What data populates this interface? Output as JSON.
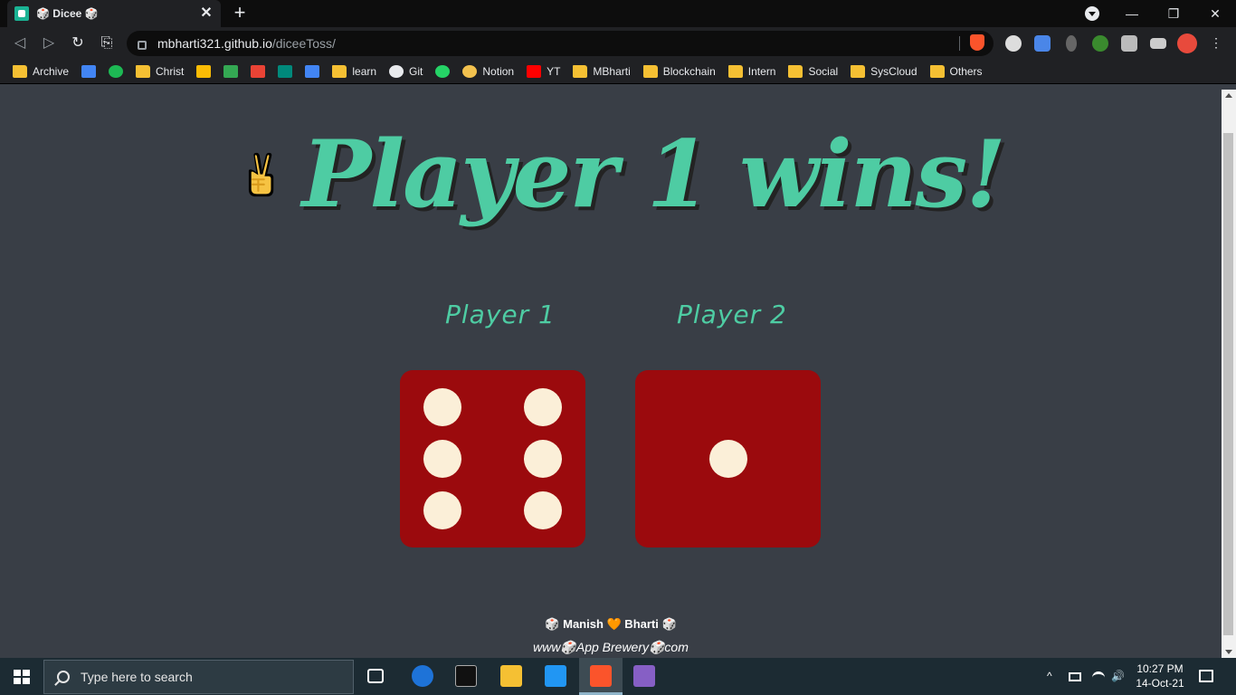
{
  "browser": {
    "tab_title": "🎲 Dicee 🎲",
    "tab_close": "✕",
    "new_tab": "+",
    "url_host": "mbharti321.github.io",
    "url_path": "/diceeToss/",
    "window_controls": [
      "—",
      "❐",
      "✕"
    ]
  },
  "bookmarks": [
    {
      "label": "Archive",
      "icon": "folder-icon"
    },
    {
      "label": "",
      "icon": "gmeet-icon"
    },
    {
      "label": "",
      "icon": "spotify-icon"
    },
    {
      "label": "Christ",
      "icon": "folder-icon"
    },
    {
      "label": "",
      "icon": "google-photos-icon"
    },
    {
      "label": "",
      "icon": "google-drive-icon"
    },
    {
      "label": "",
      "icon": "gmail-icon"
    },
    {
      "label": "",
      "icon": "google-meet-icon"
    },
    {
      "label": "",
      "icon": "calendar-icon"
    },
    {
      "label": "learn",
      "icon": "folder-icon"
    },
    {
      "label": "Git",
      "icon": "github-icon"
    },
    {
      "label": "",
      "icon": "whatsapp-icon"
    },
    {
      "label": "Notion",
      "icon": "notion-icon"
    },
    {
      "label": "YT",
      "icon": "youtube-icon"
    },
    {
      "label": "MBharti",
      "icon": "folder-icon"
    },
    {
      "label": "Blockchain",
      "icon": "folder-icon"
    },
    {
      "label": "Intern",
      "icon": "folder-icon"
    },
    {
      "label": "Social",
      "icon": "folder-icon"
    },
    {
      "label": "SysCloud",
      "icon": "folder-icon"
    },
    {
      "label": "Others",
      "icon": "folder-icon"
    }
  ],
  "game": {
    "result": "Player 1 wins!",
    "player1_label": "Player 1",
    "player2_label": "Player 2",
    "player1_die": 6,
    "player2_die": 1,
    "colors": {
      "accent": "#4ecca3",
      "background": "#393e46",
      "die": "#9b0a0d",
      "pip": "#fbefd8"
    }
  },
  "footer": {
    "line1": "🎲 Manish 🧡 Bharti 🎲",
    "line2": "www🎲App Brewery🎲com"
  },
  "taskbar": {
    "search_placeholder": "Type here to search",
    "time": "10:27 PM",
    "date": "14-Oct-21",
    "tray_arrow": "^"
  }
}
